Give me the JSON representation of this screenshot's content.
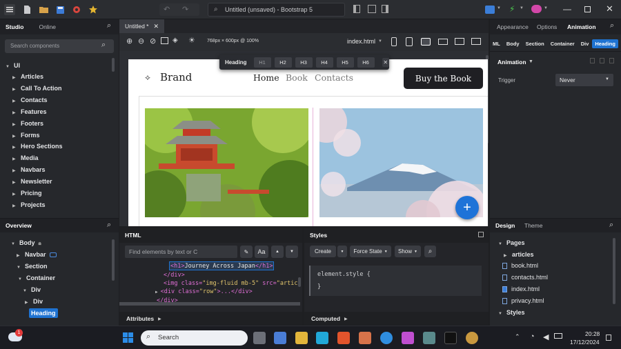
{
  "titlebar": {
    "title": "Untitled (unsaved) - Bootstrap 5"
  },
  "studio": {
    "tabs": [
      "Studio",
      "Online"
    ],
    "search_placeholder": "Search components",
    "root": "UI",
    "items": [
      "Articles",
      "Call To Action",
      "Contacts",
      "Features",
      "Footers",
      "Forms",
      "Hero Sections",
      "Media",
      "Navbars",
      "Newsletter",
      "Pricing",
      "Projects"
    ]
  },
  "overview": {
    "title": "Overview",
    "nodes": [
      "Body",
      "Navbar",
      "Section",
      "Container",
      "Div",
      "Div",
      "Heading"
    ]
  },
  "editor": {
    "tab": "Untitled *",
    "size": "768px × 600px @ 100%",
    "file": "index.html"
  },
  "heading_toolbar": {
    "label": "Heading",
    "levels": [
      "H1",
      "H2",
      "H3",
      "H4",
      "H5",
      "H6"
    ]
  },
  "site": {
    "brand": "Brand",
    "nav": [
      "Home",
      "Book",
      "Contacts"
    ],
    "cta": "Buy the Book"
  },
  "html_panel": {
    "title": "HTML",
    "find_placeholder": "Find elements by text or C",
    "aa": "Aa",
    "lines": [
      {
        "tag_open": "<h1>",
        "text": "Journey Across Japan",
        "tag_close": "</h1>"
      },
      {
        "text": "</div>"
      },
      {
        "pre": "<img class=",
        "attr1": "\"img-fluid mb-5\"",
        "mid": " src=",
        "attr2": "\"articles/header"
      },
      {
        "pre": "<div class=",
        "attr1": "\"row\"",
        "mid": ">...</div>"
      },
      {
        "text": "</div>"
      }
    ]
  },
  "styles_panel": {
    "title": "Styles",
    "create": "Create",
    "force_state": "Force State",
    "show": "Show",
    "rule": "element.style {",
    "close": "}"
  },
  "bottom": {
    "attributes": "Attributes",
    "computed": "Computed"
  },
  "right": {
    "tabs": [
      "Appearance",
      "Options",
      "Animation"
    ],
    "crumbs": [
      "ML",
      "Body",
      "Section",
      "Container",
      "Div",
      "Heading"
    ],
    "animation_label": "Animation",
    "trigger_label": "Trigger",
    "trigger_value": "Never"
  },
  "design": {
    "tabs": [
      "Design",
      "Theme"
    ],
    "pages_label": "Pages",
    "folder": "articles",
    "files": [
      "book.html",
      "contacts.html",
      "index.html",
      "privacy.html"
    ],
    "styles_label": "Styles"
  },
  "taskbar": {
    "search": "Search",
    "time": "20:28",
    "date": "17/12/2024",
    "notification": "1"
  },
  "colors": {
    "accent": "#1e6fd9",
    "active_tab": "#1f7bd6",
    "tag": "#e06fd6",
    "attr": "#e0c46b",
    "selected_bg": "#1f73d1"
  }
}
